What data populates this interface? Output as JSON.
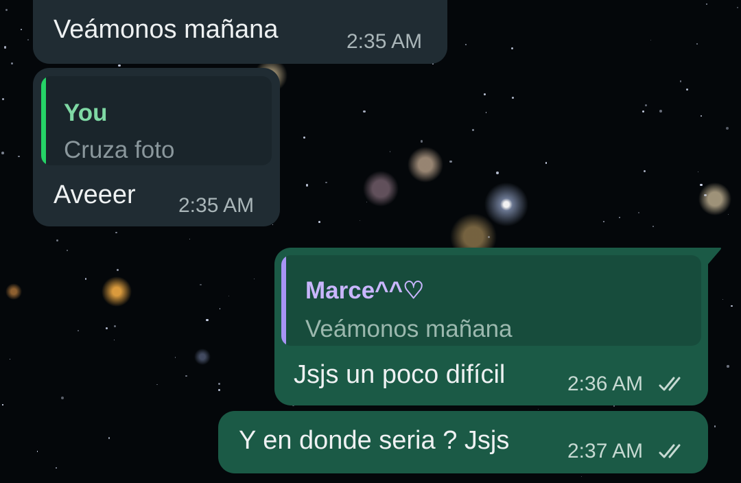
{
  "messages": [
    {
      "direction": "incoming",
      "text": "Veámonos mañana",
      "time": "2:35 AM"
    },
    {
      "direction": "incoming",
      "quote": {
        "author": "You",
        "text": "Cruza foto"
      },
      "text": "Aveeer",
      "time": "2:35 AM"
    },
    {
      "direction": "outgoing",
      "quote": {
        "author": "Marce^^♡",
        "text": "Veámonos mañana"
      },
      "text": "Jsjs un poco difícil",
      "time": "2:36 AM",
      "status": "read"
    },
    {
      "direction": "outgoing",
      "text": "Y en donde seria ? Jsjs",
      "time": "2:37 AM",
      "status": "read"
    }
  ],
  "colors": {
    "incoming_bubble": "#202c33",
    "outgoing_bubble": "#1b5a46",
    "you_quote_accent": "#25d366",
    "you_quote_name": "#7fd9a4",
    "marce_quote_accent": "#a894f5",
    "marce_quote_name": "#c9b6ff",
    "read_ticks": "#c6d9d2"
  },
  "icons": {
    "status": "double-check-icon"
  }
}
